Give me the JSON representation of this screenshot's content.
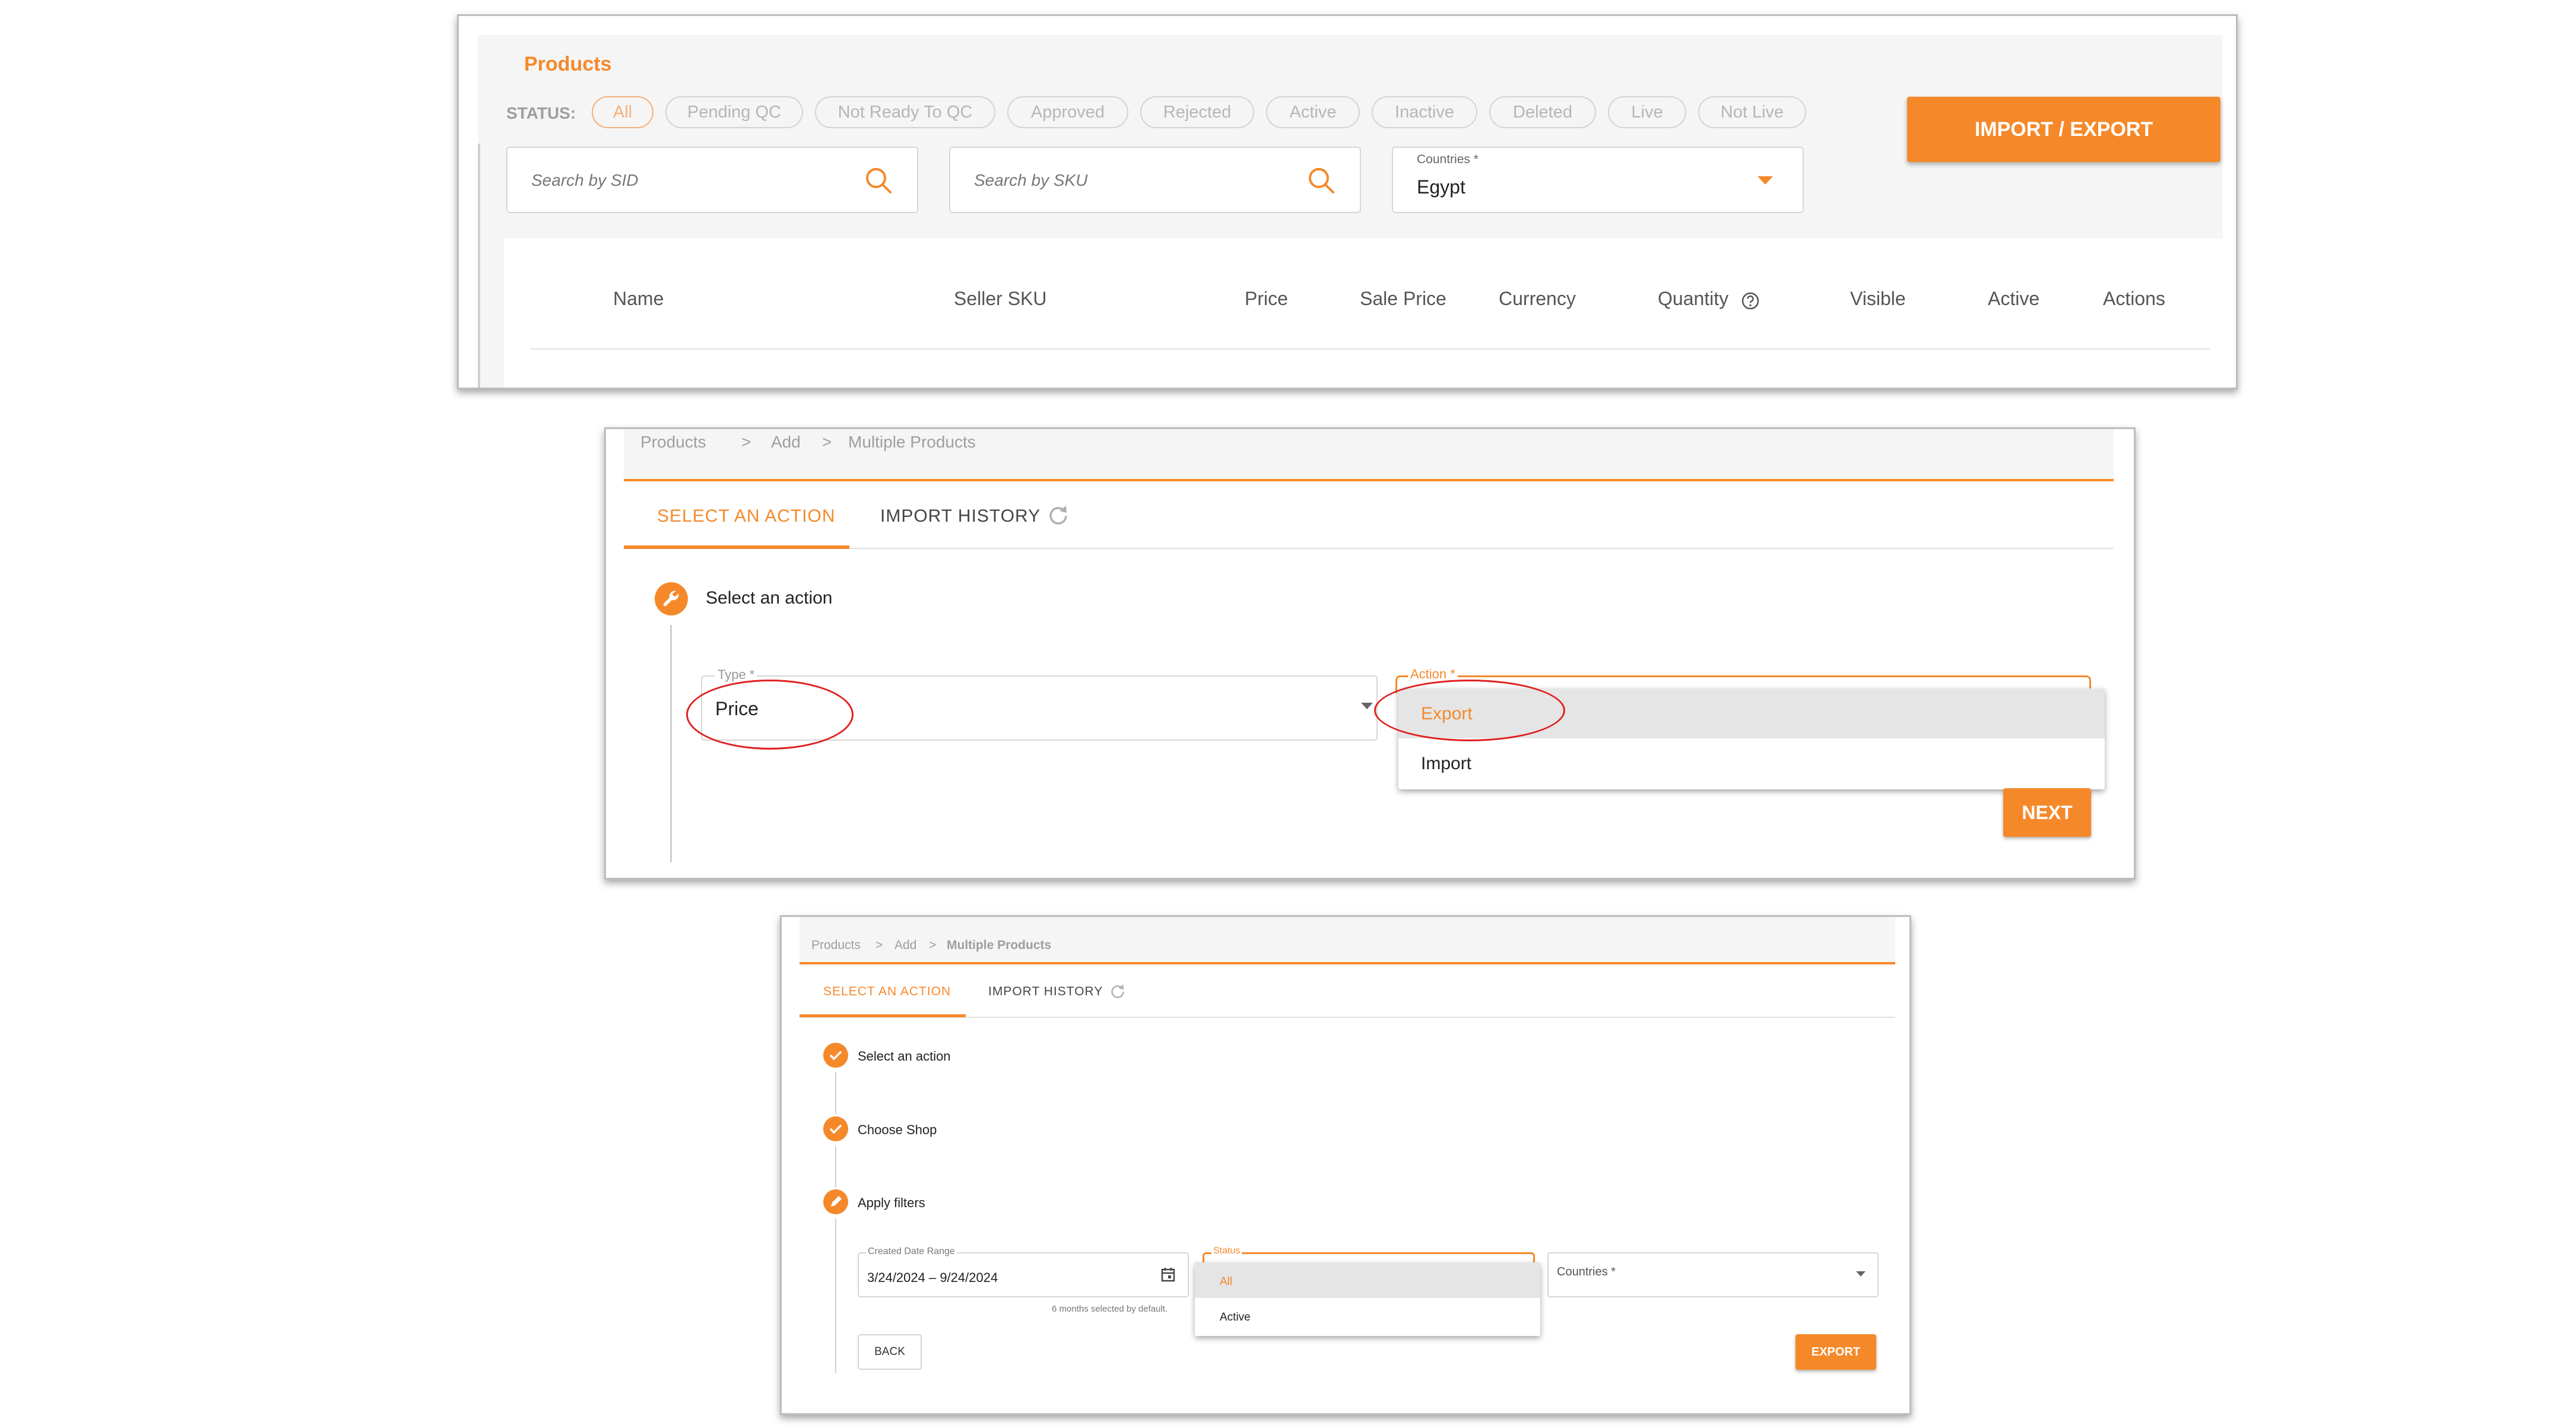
{
  "panel1": {
    "title": "Products",
    "status_label": "STATUS:",
    "status_chips": [
      "All",
      "Pending QC",
      "Not Ready To QC",
      "Approved",
      "Rejected",
      "Active",
      "Inactive",
      "Deleted",
      "Live",
      "Not Live"
    ],
    "selected_chip": "All",
    "import_export_label": "IMPORT / EXPORT",
    "search_sid_placeholder": "Search by SID",
    "search_sku_placeholder": "Search by SKU",
    "countries_label": "Countries *",
    "countries_value": "Egypt",
    "table_headers": [
      "Name",
      "Seller SKU",
      "Price",
      "Sale Price",
      "Currency",
      "Quantity",
      "Visible",
      "Active",
      "Actions"
    ]
  },
  "panel2": {
    "breadcrumb": [
      "Products",
      ">",
      "Add",
      ">",
      "Multiple Products"
    ],
    "tabs": [
      "SELECT AN ACTION",
      "IMPORT HISTORY"
    ],
    "step_title": "Select an action",
    "type_label": "Type *",
    "type_value": "Price",
    "action_label": "Action *",
    "action_options": [
      "Export",
      "Import"
    ],
    "next_label": "NEXT"
  },
  "panel3": {
    "breadcrumb": [
      "Products",
      ">",
      "Add",
      ">",
      "Multiple Products"
    ],
    "tabs": [
      "SELECT AN ACTION",
      "IMPORT HISTORY"
    ],
    "steps": [
      "Select an action",
      "Choose Shop",
      "Apply filters"
    ],
    "date_label": "Created Date Range",
    "date_value": "3/24/2024 – 9/24/2024",
    "date_hint": "6 months selected by default.",
    "status_label": "Status",
    "status_options": [
      "All",
      "Active"
    ],
    "countries_label": "Countries *",
    "back_label": "BACK",
    "export_label": "EXPORT"
  },
  "colors": {
    "accent": "#f5892a",
    "annotation": "#e02020"
  }
}
